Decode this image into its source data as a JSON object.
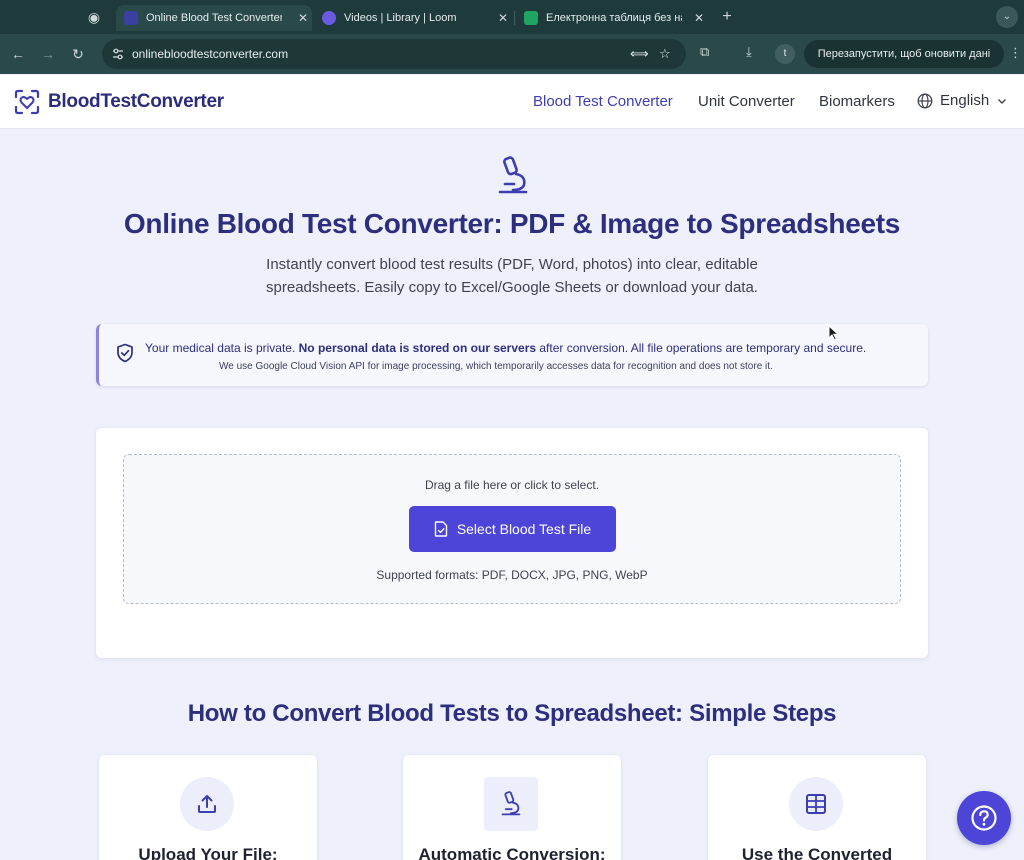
{
  "browser": {
    "tabs": [
      {
        "title": "Online Blood Test Converter",
        "active": true
      },
      {
        "title": "Videos | Library | Loom",
        "active": false
      },
      {
        "title": "Електронна таблиця без назви",
        "active": false
      }
    ],
    "url": "onlinebloodtestconverter.com",
    "relaunch_label": "Перезапустити, щоб оновити дані",
    "profile_initial": "t",
    "new_tab_symbol": "+"
  },
  "site": {
    "brand": "BloodTestConverter",
    "nav": {
      "blood_test_converter": "Blood Test Converter",
      "unit_converter": "Unit Converter",
      "biomarkers": "Biomarkers",
      "language": "English"
    }
  },
  "hero": {
    "title": "Online Blood Test Converter: PDF & Image to Spreadsheets",
    "subtitle_line1": "Instantly convert blood test results (PDF, Word, photos) into clear, editable",
    "subtitle_line2": "spreadsheets. Easily copy to Excel/Google Sheets or download your data."
  },
  "privacy": {
    "lead": "Your medical data is private. ",
    "bold": "No personal data is stored on our servers",
    "tail": " after conversion. All file operations are temporary and secure.",
    "note": "We use Google Cloud Vision API for image processing, which temporarily accesses data for recognition and does not store it."
  },
  "upload": {
    "hint": "Drag a file here or click to select.",
    "button_label": "Select Blood Test File",
    "formats": "Supported formats: PDF, DOCX, JPG, PNG, WebP"
  },
  "steps": {
    "title": "How to Convert Blood Tests to Spreadsheet: Simple Steps",
    "items": [
      {
        "title": "Upload Your File:",
        "icon": "upload-icon"
      },
      {
        "title": "Automatic Conversion:",
        "icon": "microscope-icon"
      },
      {
        "title": "Use the Converted",
        "icon": "table-icon"
      }
    ]
  },
  "colors": {
    "accent": "#4d45d8",
    "heading": "#2d2f7e",
    "browser_frame": "#2a4a4a"
  }
}
